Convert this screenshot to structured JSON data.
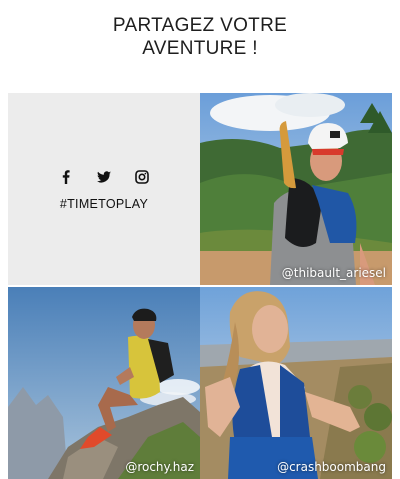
{
  "heading": {
    "line1": "PARTAGEZ VOTRE",
    "line2": "AVENTURE !"
  },
  "social": {
    "icons": [
      "facebook-icon",
      "twitter-icon",
      "instagram-icon"
    ],
    "hashtag": "#TIMETOPLAY"
  },
  "photos": [
    {
      "handle": "@thibault_ariesel"
    },
    {
      "handle": "@rochy.haz"
    },
    {
      "handle": "@crashboombang"
    }
  ],
  "colors": {
    "panel_bg": "#ececec",
    "text": "#111111"
  }
}
